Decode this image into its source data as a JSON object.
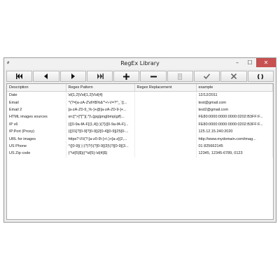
{
  "window": {
    "title": "RegEx Library",
    "app_icon": "ꬾ"
  },
  "window_controls": {
    "minimize": "–",
    "maximize": "☐",
    "close": "✕"
  },
  "toolbar": [
    {
      "name": "first-record-icon"
    },
    {
      "name": "previous-record-icon"
    },
    {
      "name": "next-record-icon"
    },
    {
      "name": "last-record-icon"
    },
    {
      "name": "add-icon"
    },
    {
      "name": "remove-icon"
    },
    {
      "name": "edit-icon"
    },
    {
      "name": "checkmark-icon"
    },
    {
      "name": "cancel-icon"
    },
    {
      "name": "refresh-icon"
    }
  ],
  "table": {
    "columns": [
      "Description",
      "Regex Pattern",
      "Regex Replacement",
      "example"
    ],
    "rows": [
      [
        "Date",
        "\\d{1,2}\\/\\d{1,2}\\/\\d{4}",
        "",
        "12/12/2011"
      ],
      [
        "Email",
        "^(?=[a-zA-Z\\d!#$%&'*+\\-\\/=?^_`{|...",
        "",
        "test@gmail.com"
      ],
      [
        "Email 2",
        "[a-zA-Z0-9_%-]+@[a-zA-Z0-9-]+...",
        "",
        "test2@gmail.com"
      ],
      [
        "HTML images sources",
        "src[^>]*[\"'](.*)\\.(jpg|png|bmp|gif)...",
        "",
        "FE80:0000:0000:0000:0202:B3FF:F..."
      ],
      [
        "IP v6",
        "(([0-9a-fA-F]{1,4}):){7}([0-9a-fA-F]...",
        "",
        "FE80:0000:0000:0000:0202:B3FF:F..."
      ],
      [
        "IP:Port (Proxy)",
        "(([01]?[0-9]?[0-9]|2[0-4][0-9]|25[0-...",
        "",
        "125.12.15.240:2020"
      ],
      [
        "URL for images",
        "https?:\\/\\/(?:[a-z0-9\\-]+\\.)+[a-z]{2,...",
        "",
        "http://www.mydomain.com/imag..."
      ],
      [
        "US Phone",
        "^([0-9]( |-)?)?(\\(?[0-9]{3}\\)?|[0-9]{3...",
        "",
        "01 825662145"
      ],
      [
        "US Zip code",
        "(^\\d{5}$)|(^\\d{5}-\\d{4}$)",
        "",
        "12345, 12345-6789, 0123"
      ]
    ]
  }
}
